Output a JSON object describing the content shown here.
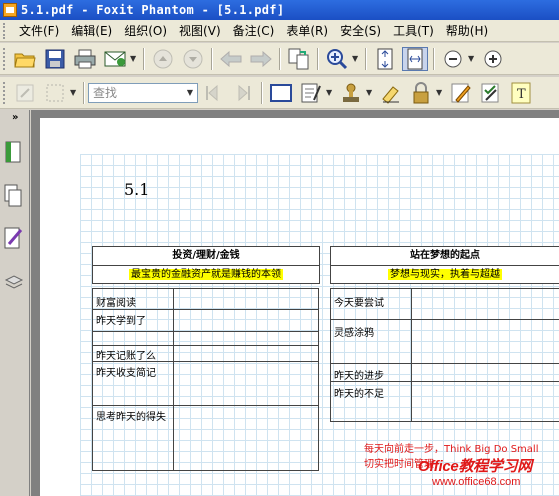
{
  "window": {
    "title": "5.1.pdf - Foxit Phantom - [5.1.pdf]"
  },
  "menu": {
    "items": [
      {
        "label": "文件(F)"
      },
      {
        "label": "编辑(E)"
      },
      {
        "label": "组织(O)"
      },
      {
        "label": "视图(V)"
      },
      {
        "label": "备注(C)"
      },
      {
        "label": "表单(R)"
      },
      {
        "label": "安全(S)"
      },
      {
        "label": "工具(T)"
      },
      {
        "label": "帮助(H)"
      }
    ]
  },
  "toolbar": {
    "search_placeholder": "查找",
    "icons": [
      "open-folder-icon",
      "save-icon",
      "print-icon",
      "email-icon",
      "page-up-icon",
      "page-down-icon",
      "back-icon",
      "forward-icon",
      "extract-pages-icon",
      "zoom-in-icon",
      "fit-page-icon",
      "fit-width-icon",
      "zoom-out-icon",
      "zoom-plus-icon",
      "hand-tool-icon",
      "select-area-icon",
      "find-prev-icon",
      "find-next-icon",
      "single-page-icon",
      "note-icon",
      "stamp-icon",
      "highlight-icon",
      "lock-icon",
      "pencil-icon",
      "typewriter-icon",
      "text-tool-icon"
    ]
  },
  "document": {
    "page_number": "5.1",
    "left_section": {
      "title": "投资/理财/金钱",
      "subtitle": "最宝贵的金融资产就是赚钱的本领",
      "rows": [
        "财富阅读",
        "昨天学到了",
        "昨天记账了么",
        "昨天收支简记",
        "思考昨天的得失"
      ]
    },
    "right_section": {
      "title": "站在梦想的起点",
      "subtitle": "梦想与现实，执着与超越",
      "rows": [
        "今天要尝试",
        "灵感涂鸦",
        "昨天的进步",
        "昨天的不足"
      ]
    },
    "note_line1": "每天向前走一步，Think Big Do Small",
    "note_line2": "切实把时间管理"
  },
  "watermark": {
    "line1": "Office教程学习网",
    "line2": "www.office68.com"
  },
  "colors": {
    "titlebar": "#1b4fc4",
    "highlight": "#ffff00",
    "note_red": "#e01818",
    "grid": "#cfe3f0"
  }
}
